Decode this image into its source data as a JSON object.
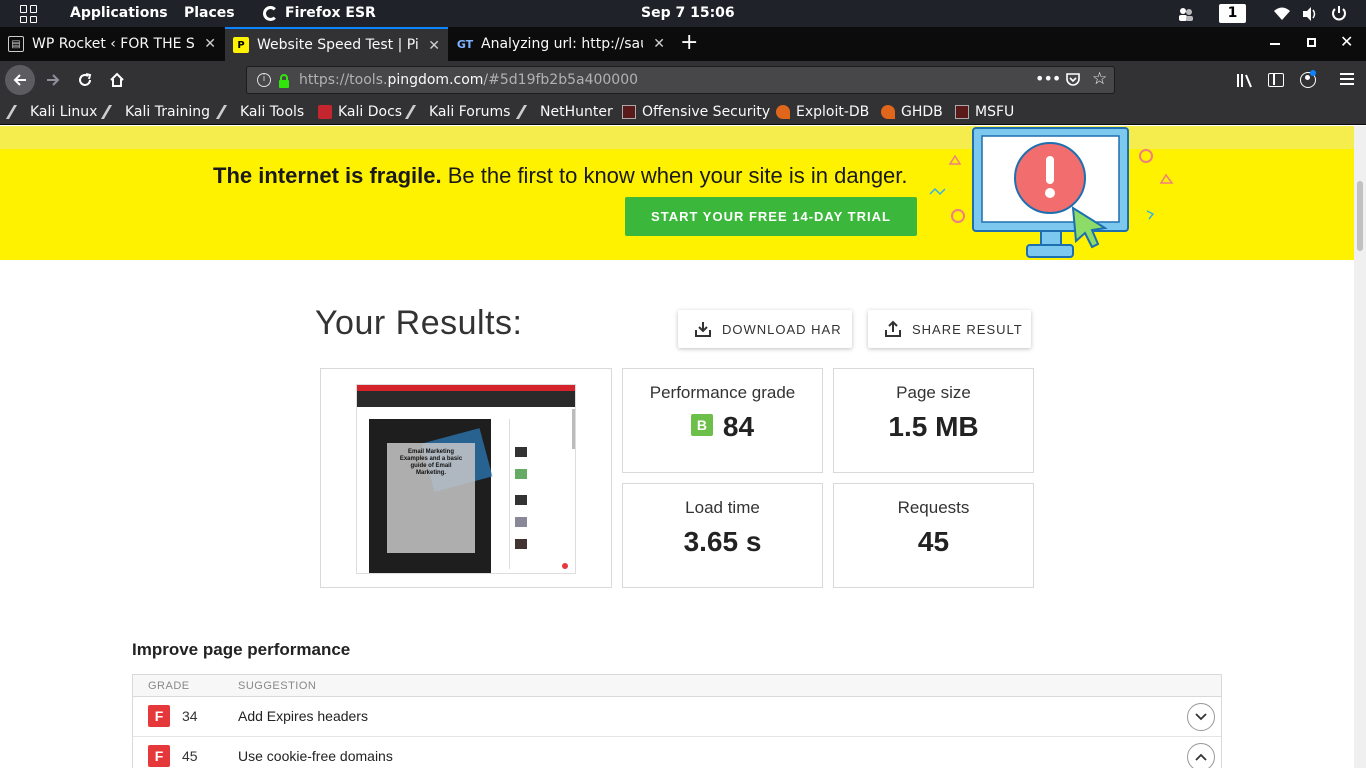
{
  "system_panel": {
    "applications": "Applications",
    "places": "Places",
    "browser": "Firefox ESR",
    "clock": "Sep 7  15:06",
    "workspace": "1"
  },
  "tabs": [
    {
      "title": "WP Rocket ‹ FOR THE SAKE",
      "active": false
    },
    {
      "title": "Website Speed Test | Pingdom",
      "active": true
    },
    {
      "title": "Analyzing url: http://saura",
      "active": false
    }
  ],
  "url": {
    "prefix": "https://tools.",
    "domain": "pingdom.com",
    "suffix": "/#5d19fb2b5a400000"
  },
  "bookmarks": [
    "Kali Linux",
    "Kali Training",
    "Kali Tools",
    "Kali Docs",
    "Kali Forums",
    "NetHunter",
    "Offensive Security",
    "Exploit-DB",
    "GHDB",
    "MSFU"
  ],
  "banner": {
    "headline_bold": "The internet is fragile.",
    "headline_rest": " Be the first to know when your site is in danger.",
    "cta": "START YOUR FREE 14-DAY TRIAL"
  },
  "results": {
    "title": "Your Results:",
    "download_har": "DOWNLOAD HAR",
    "share_result": "SHARE RESULT",
    "thumbnail_text": "Email Marketing Examples and a basic guide of Email Marketing.",
    "performance_grade_label": "Performance grade",
    "performance_grade_letter": "B",
    "performance_grade_value": "84",
    "page_size_label": "Page size",
    "page_size_value": "1.5 MB",
    "load_time_label": "Load time",
    "load_time_value": "3.65 s",
    "requests_label": "Requests",
    "requests_value": "45"
  },
  "improve": {
    "title": "Improve page performance",
    "col_grade": "GRADE",
    "col_suggestion": "SUGGESTION",
    "rows": [
      {
        "grade": "F",
        "score": "34",
        "suggestion": "Add Expires headers",
        "expanded": false
      },
      {
        "grade": "F",
        "score": "45",
        "suggestion": "Use cookie-free domains",
        "expanded": true
      }
    ]
  },
  "colors": {
    "banner": "#fff200",
    "cta": "#3bb83b",
    "grade_b": "#6cc04a",
    "grade_f": "#e5383b",
    "tab_accent": "#0a84ff"
  }
}
